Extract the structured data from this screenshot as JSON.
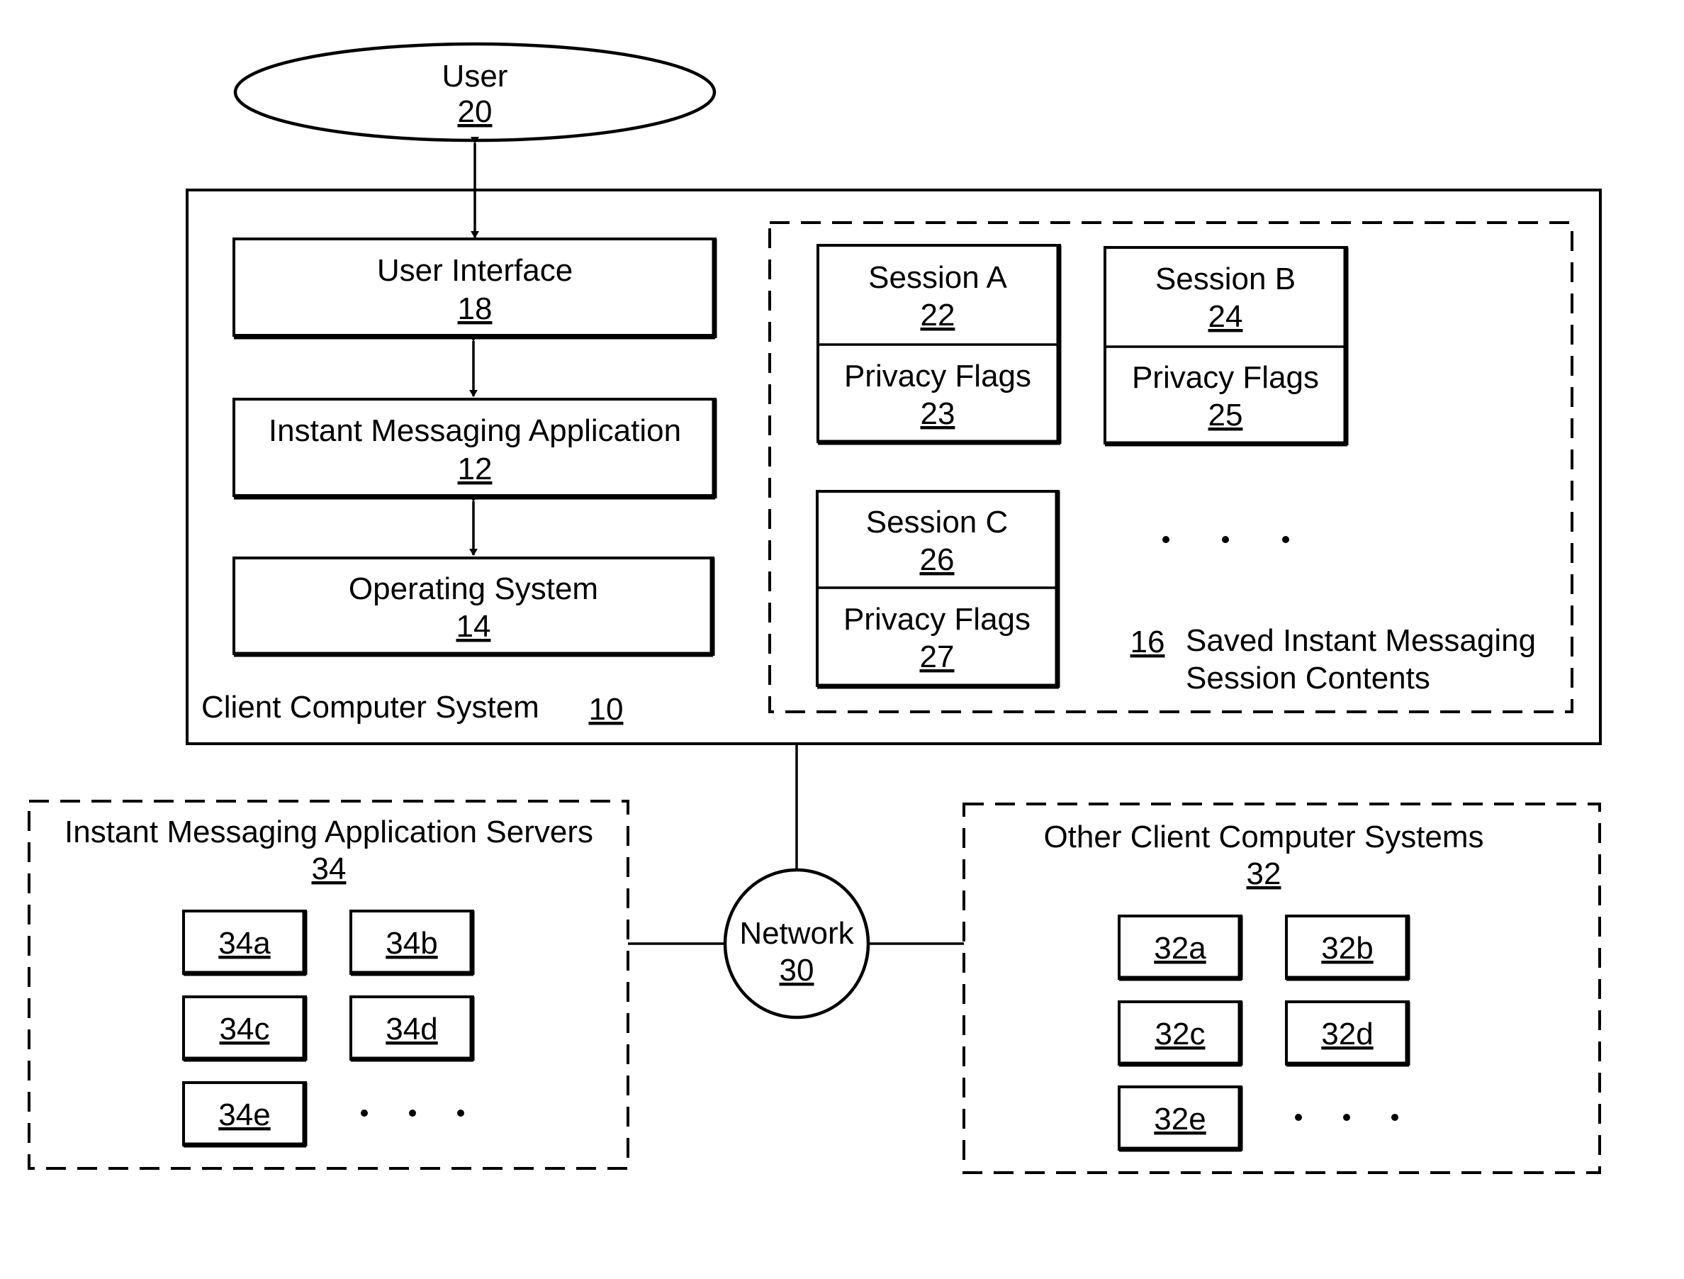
{
  "diagram": {
    "user": {
      "label": "User",
      "ref": "20"
    },
    "client": {
      "label": "Client Computer System",
      "ref": "10"
    },
    "user_interface": {
      "label": "User Interface",
      "ref": "18"
    },
    "im_application": {
      "label": "Instant Messaging Application",
      "ref": "12"
    },
    "operating_system": {
      "label": "Operating System",
      "ref": "14"
    },
    "saved_contents": {
      "ref": "16",
      "label_line1": "Saved Instant Messaging",
      "label_line2": "Session Contents"
    },
    "sessions": [
      {
        "label": "Session A",
        "ref": "22",
        "flags_label": "Privacy Flags",
        "flags_ref": "23"
      },
      {
        "label": "Session B",
        "ref": "24",
        "flags_label": "Privacy Flags",
        "flags_ref": "25"
      },
      {
        "label": "Session C",
        "ref": "26",
        "flags_label": "Privacy Flags",
        "flags_ref": "27"
      }
    ],
    "network": {
      "label": "Network",
      "ref": "30"
    },
    "servers": {
      "label": "Instant Messaging Application Servers",
      "ref": "34",
      "items": [
        "34a",
        "34b",
        "34c",
        "34d",
        "34e"
      ]
    },
    "other_clients": {
      "label": "Other Client Computer Systems",
      "ref": "32",
      "items": [
        "32a",
        "32b",
        "32c",
        "32d",
        "32e"
      ]
    },
    "ellipsis": "· · ·"
  }
}
